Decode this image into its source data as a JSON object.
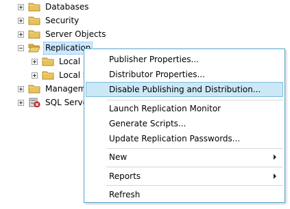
{
  "tree": {
    "databases": "Databases",
    "security": "Security",
    "server_objects": "Server Objects",
    "replication": "Replication",
    "local_publications": "Local P",
    "local_subscriptions": "Local S",
    "management": "Manageme",
    "sql_server_agent": "SQL Serve"
  },
  "context_menu": {
    "publisher_properties": "Publisher Properties...",
    "distributor_properties": "Distributor Properties...",
    "disable_publishing": "Disable Publishing and Distribution...",
    "launch_monitor": "Launch Replication Monitor",
    "generate_scripts": "Generate Scripts...",
    "update_passwords": "Update Replication Passwords...",
    "new": "New",
    "reports": "Reports",
    "refresh": "Refresh"
  },
  "colors": {
    "menu_border": "#52a6cf",
    "highlight": "#cce8f6",
    "selection": "#cde8ff",
    "folder": "#e8c25a"
  }
}
